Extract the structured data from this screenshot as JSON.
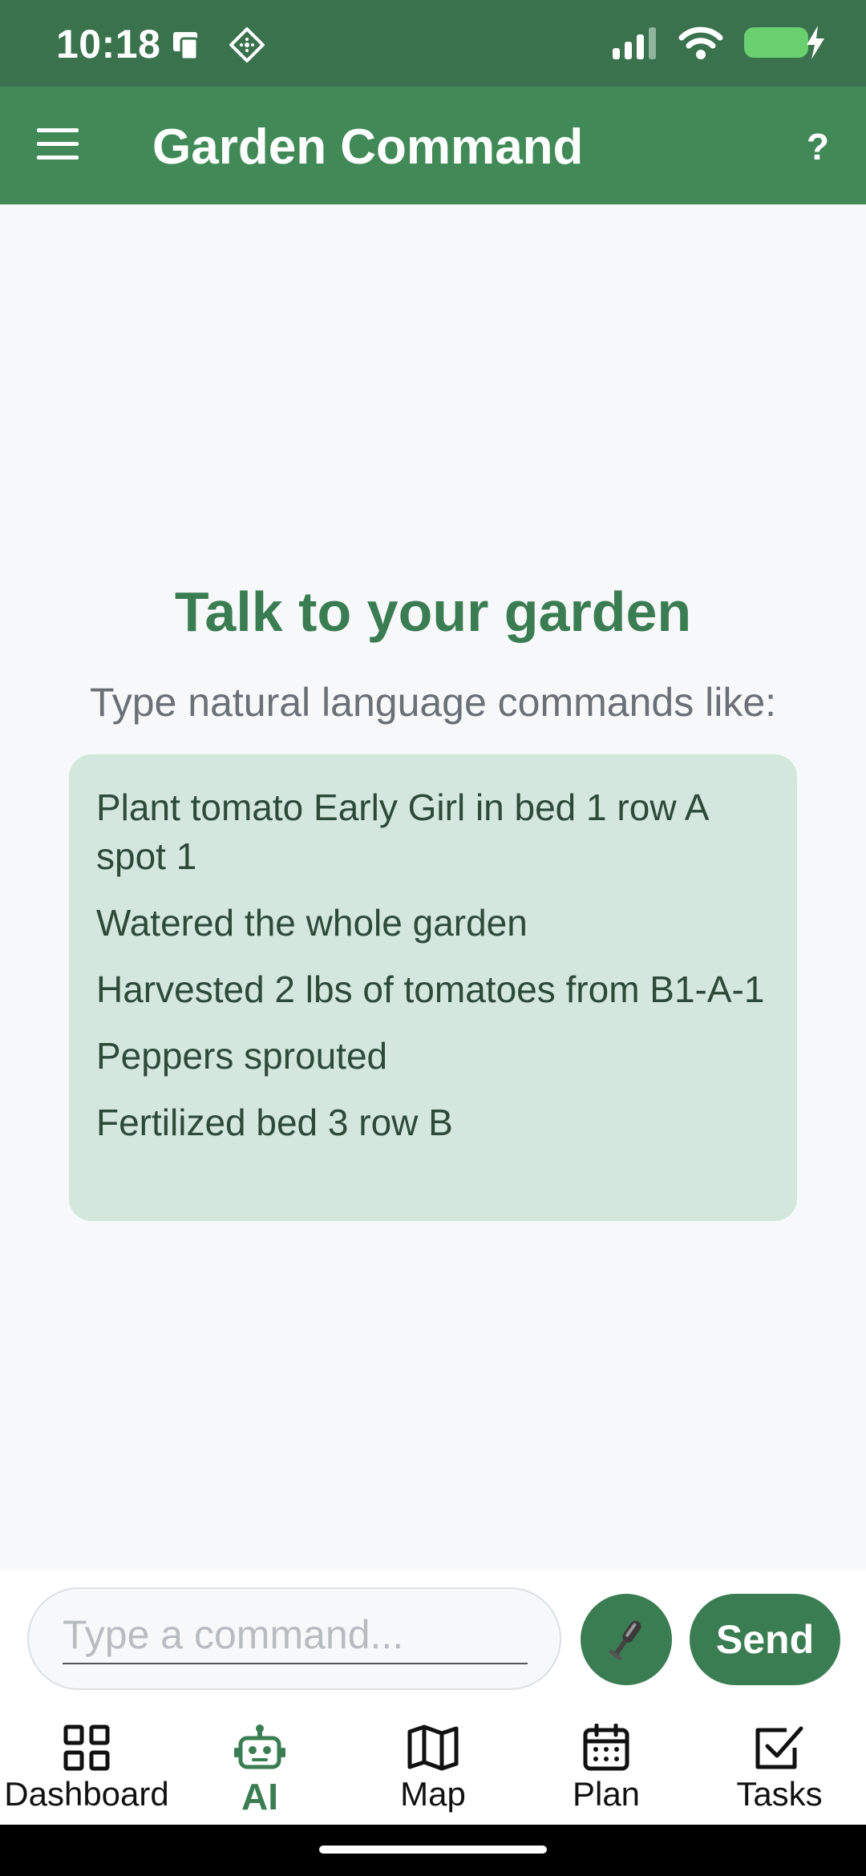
{
  "status_bar": {
    "time": "10:18",
    "colors": {
      "background": "#3a724e"
    },
    "icons": [
      "device-icon",
      "nfc-icon",
      "signal-icon",
      "wifi-icon",
      "battery-charging-icon"
    ]
  },
  "app_bar": {
    "title": "Garden Command",
    "help_label": "?",
    "colors": {
      "background": "#418a58"
    },
    "icons": [
      "menu-icon"
    ]
  },
  "main": {
    "heading": "Talk to your garden",
    "subheading": "Type natural language commands like:",
    "examples": [
      "Plant tomato Early Girl in bed 1 row A spot 1",
      "Watered the whole garden",
      "Harvested 2 lbs of tomatoes from B1-A-1",
      "Peppers sprouted",
      "Fertilized bed 3 row B"
    ]
  },
  "input_bar": {
    "placeholder": "Type a command...",
    "value": "",
    "send_label": "Send",
    "icons": [
      "microphone-icon"
    ]
  },
  "bottom_nav": {
    "active": "AI",
    "items": [
      {
        "label": "Dashboard",
        "icon": "dashboard-grid-icon"
      },
      {
        "label": "AI",
        "icon": "robot-icon"
      },
      {
        "label": "Map",
        "icon": "map-icon"
      },
      {
        "label": "Plan",
        "icon": "calendar-icon"
      },
      {
        "label": "Tasks",
        "icon": "checkbox-icon"
      }
    ]
  },
  "colors": {
    "accent": "#3b7d52",
    "example_card": "#d4e7dd",
    "background": "#f7f8fa"
  }
}
